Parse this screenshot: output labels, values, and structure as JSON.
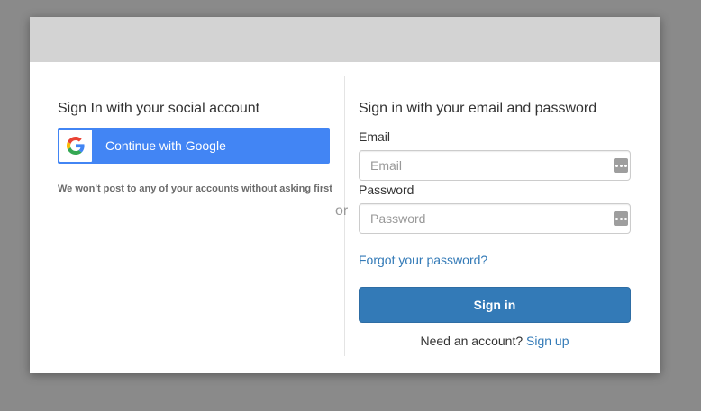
{
  "social": {
    "heading": "Sign In with your social account",
    "google_button_label": "Continue with Google",
    "disclaimer": "We won't post to any of your accounts without asking first"
  },
  "divider": {
    "or_label": "or"
  },
  "email_form": {
    "heading": "Sign in with your email and password",
    "email_label": "Email",
    "email_placeholder": "Email",
    "email_value": "",
    "password_label": "Password",
    "password_placeholder": "Password",
    "password_value": "",
    "forgot_link": "Forgot your password?",
    "signin_button": "Sign in",
    "signup_prompt": "Need an account?",
    "signup_link": "Sign up"
  },
  "colors": {
    "google_blue": "#4285f4",
    "primary_button": "#337ab7",
    "link": "#337ab7",
    "header_bar": "#d3d3d3",
    "backdrop": "#8a8a8a"
  },
  "icons": {
    "google": "google-g-icon",
    "password_manager": "password-manager-icon"
  }
}
